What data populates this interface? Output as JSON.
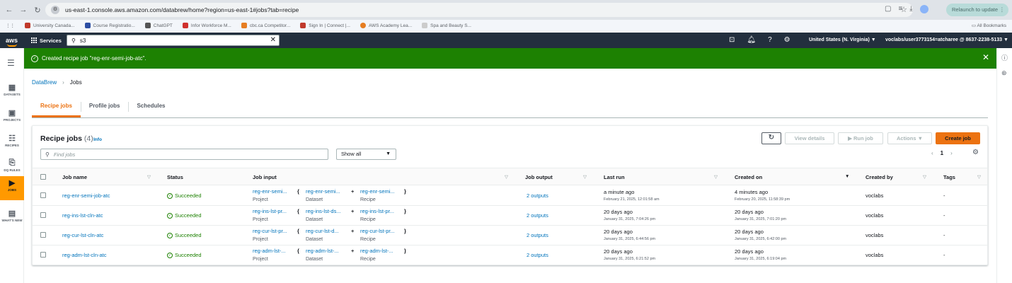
{
  "browser": {
    "url": "us-east-1.console.aws.amazon.com/databrew/home?region=us-east-1#jobs?tab=recipe",
    "relaunch_label": "Relaunch to update",
    "bookmarks": [
      "University Canada...",
      "Course Registratio...",
      "ChatGPT",
      "Infor Workforce M...",
      "cbc.ca Competitor...",
      "Sign In | Connect |...",
      "AWS Academy Lea...",
      "Spa and Beauty S..."
    ],
    "all_bookmarks_label": "All Bookmarks"
  },
  "aws": {
    "logo": "aws",
    "services_label": "Services",
    "search_value": "s3",
    "region": "United States (N. Virginia) ▼",
    "account": "voclabs/user3773154=atcharee @ 8637-2238-5133 ▼"
  },
  "leftnav": {
    "items": [
      {
        "label": "DATASETS",
        "icon": "table-icon"
      },
      {
        "label": "PROJECTS",
        "icon": "grid-icon"
      },
      {
        "label": "RECIPES",
        "icon": "list-icon"
      },
      {
        "label": "DQ RULES",
        "icon": "rules-icon"
      },
      {
        "label": "JOBS",
        "icon": "play-icon"
      },
      {
        "label": "WHAT'S NEW",
        "icon": "news-icon"
      }
    ]
  },
  "flash": {
    "message": "Created recipe job \"reg-enr-semi-job-atc\"."
  },
  "breadcrumb": {
    "root": "DataBrew",
    "current": "Jobs"
  },
  "tabs": [
    "Recipe jobs",
    "Profile jobs",
    "Schedules"
  ],
  "panel": {
    "title": "Recipe jobs",
    "count": "(4)",
    "info": "Info",
    "buttons": {
      "view_details": "View details",
      "run_job": "▶ Run job",
      "actions": "Actions ▼",
      "create_job": "Create job"
    },
    "search_placeholder": "Find jobs",
    "filter": "Show all",
    "page": "1"
  },
  "table": {
    "headers": {
      "job_name": "Job name",
      "status": "Status",
      "job_input": "Job input",
      "job_output": "Job output",
      "last_run": "Last run",
      "created_on": "Created on",
      "created_by": "Created by",
      "tags": "Tags"
    },
    "rows": [
      {
        "job_name": "reg-enr-semi-job-atc",
        "status": "Succeeded",
        "project": "reg-enr-semi...",
        "dataset": "reg-enr-semi...",
        "recipe": "reg-enr-semi...",
        "project_label": "Project",
        "dataset_label": "Dataset",
        "recipe_label": "Recipe",
        "output": "2 outputs",
        "last_run": "a minute ago",
        "last_run_exact": "February 21, 2025, 12:01:58 am",
        "created": "4 minutes ago",
        "created_exact": "February 20, 2025, 11:58:39 pm",
        "created_by": "voclabs",
        "tags": "-"
      },
      {
        "job_name": "reg-ins-lst-cln-atc",
        "status": "Succeeded",
        "project": "reg-ins-lst-pr...",
        "dataset": "reg-ins-lst-ds...",
        "recipe": "reg-ins-lst-pr...",
        "project_label": "Project",
        "dataset_label": "Dataset",
        "recipe_label": "Recipe",
        "output": "2 outputs",
        "last_run": "20 days ago",
        "last_run_exact": "January 31, 2025, 7:04:26 pm",
        "created": "20 days ago",
        "created_exact": "January 31, 2025, 7:01:20 pm",
        "created_by": "voclabs",
        "tags": "-"
      },
      {
        "job_name": "reg-cur-lst-cln-atc",
        "status": "Succeeded",
        "project": "reg-cur-lst-pr...",
        "dataset": "reg-cur-lst-d...",
        "recipe": "reg-cur-lst-pr...",
        "project_label": "Project",
        "dataset_label": "Dataset",
        "recipe_label": "Recipe",
        "output": "2 outputs",
        "last_run": "20 days ago",
        "last_run_exact": "January 31, 2025, 6:44:56 pm",
        "created": "20 days ago",
        "created_exact": "January 31, 2025, 6:42:00 pm",
        "created_by": "voclabs",
        "tags": "-"
      },
      {
        "job_name": "reg-adm-lst-cln-atc",
        "status": "Succeeded",
        "project": "reg-adm-lst-...",
        "dataset": "reg-adm-lst-...",
        "recipe": "reg-adm-lst-...",
        "project_label": "Project",
        "dataset_label": "Dataset",
        "recipe_label": "Recipe",
        "output": "2 outputs",
        "last_run": "20 days ago",
        "last_run_exact": "January 31, 2025, 6:21:52 pm",
        "created": "20 days ago",
        "created_exact": "January 31, 2025, 6:19:04 pm",
        "created_by": "voclabs",
        "tags": "-"
      }
    ]
  },
  "colors": {
    "aws_nav": "#232f3e",
    "accent": "#ec7211",
    "success": "#1d8102",
    "link": "#0073bb"
  }
}
